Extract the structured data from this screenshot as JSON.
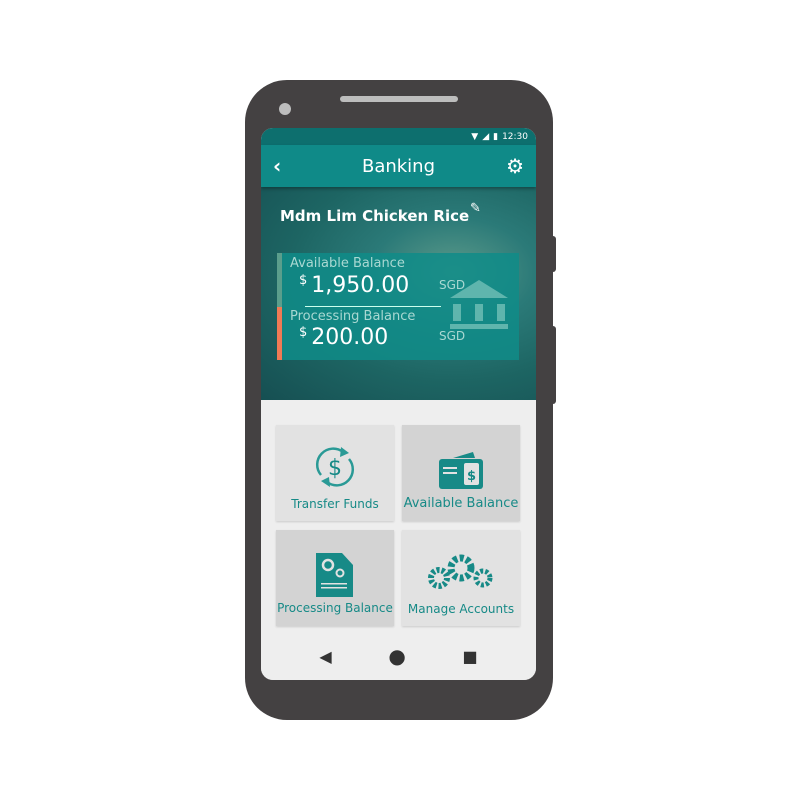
{
  "status": {
    "time": "12:30"
  },
  "appbar": {
    "title": "Banking"
  },
  "hero": {
    "name": "Mdm Lim Chicken Rice",
    "available": {
      "label": "Available Balance",
      "currency_symbol": "$",
      "amount": "1,950.00",
      "currency": "SGD"
    },
    "processing": {
      "label": "Processing Balance",
      "currency_symbol": "$",
      "amount": "200.00",
      "currency": "SGD"
    }
  },
  "tiles": [
    {
      "label": "Transfer Funds",
      "icon": "transfer-dollar-icon"
    },
    {
      "label": "Available Balance",
      "icon": "wallet-icon"
    },
    {
      "label": "Processing Balance",
      "icon": "document-gears-icon"
    },
    {
      "label": "Manage Accounts",
      "icon": "gears-icon"
    }
  ],
  "colors": {
    "primary": "#0f8a88",
    "accent": "#f07a55"
  }
}
